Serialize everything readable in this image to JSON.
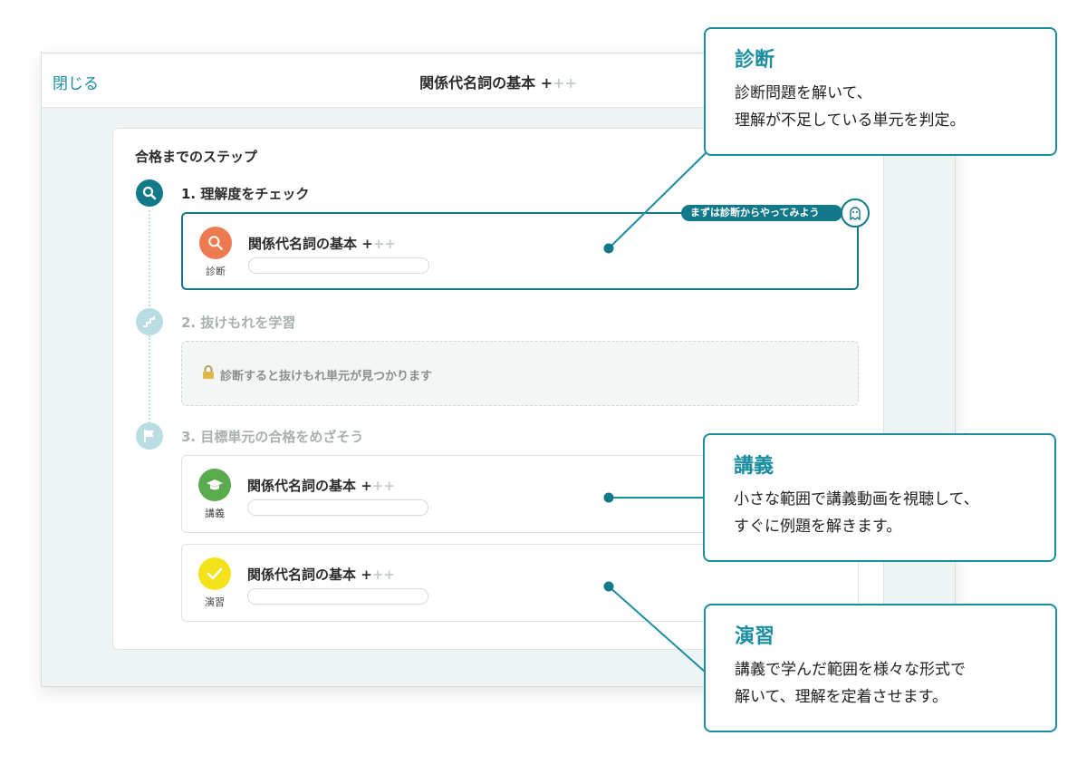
{
  "window": {
    "close_label": "閉じる",
    "title": "関係代名詞の基本",
    "title_plus_dark": "+",
    "title_plus_light": "++"
  },
  "card": {
    "title": "合格までのステップ",
    "steps": [
      {
        "label": "1. 理解度をチェック",
        "icon": "search-icon",
        "state": "active"
      },
      {
        "label": "2. 抜けもれを学習",
        "icon": "stairs-icon",
        "state": "inactive"
      },
      {
        "label": "3. 目標単元の合格をめざそう",
        "icon": "flag-icon",
        "state": "inactive"
      }
    ],
    "units": [
      {
        "title": "関係代名詞の基本",
        "plus_dark": "+",
        "plus_light": "++",
        "type": "診断",
        "icon": "search-icon",
        "color": "#ee7b4f"
      },
      {
        "title": "関係代名詞の基本",
        "plus_dark": "+",
        "plus_light": "++",
        "type": "講義",
        "icon": "graduation-cap-icon",
        "color": "#5aaa4e"
      },
      {
        "title": "関係代名詞の基本",
        "plus_dark": "+",
        "plus_light": "++",
        "type": "演習",
        "icon": "checkmark-icon",
        "color": "#f3e21a"
      }
    ],
    "locked_text": "診断すると抜けもれ単元が見つかります",
    "hint_pill": "まずは診断からやってみよう"
  },
  "callouts": [
    {
      "title": "診断",
      "line1": "診断問題を解いて、",
      "line2": "理解が不足している単元を判定。"
    },
    {
      "title": "講義",
      "line1": "小さな範囲で講義動画を視聴して、",
      "line2": "すぐに例題を解きます。"
    },
    {
      "title": "演習",
      "line1": "講義で学んだ範囲を様々な形式で",
      "line2": "解いて、理解を定着させます。"
    }
  ],
  "colors": {
    "accent": "#12798a",
    "callout_border": "#1a8ea0",
    "diagnosis": "#ee7b4f",
    "lecture": "#5aaa4e",
    "practice": "#f3e21a"
  }
}
